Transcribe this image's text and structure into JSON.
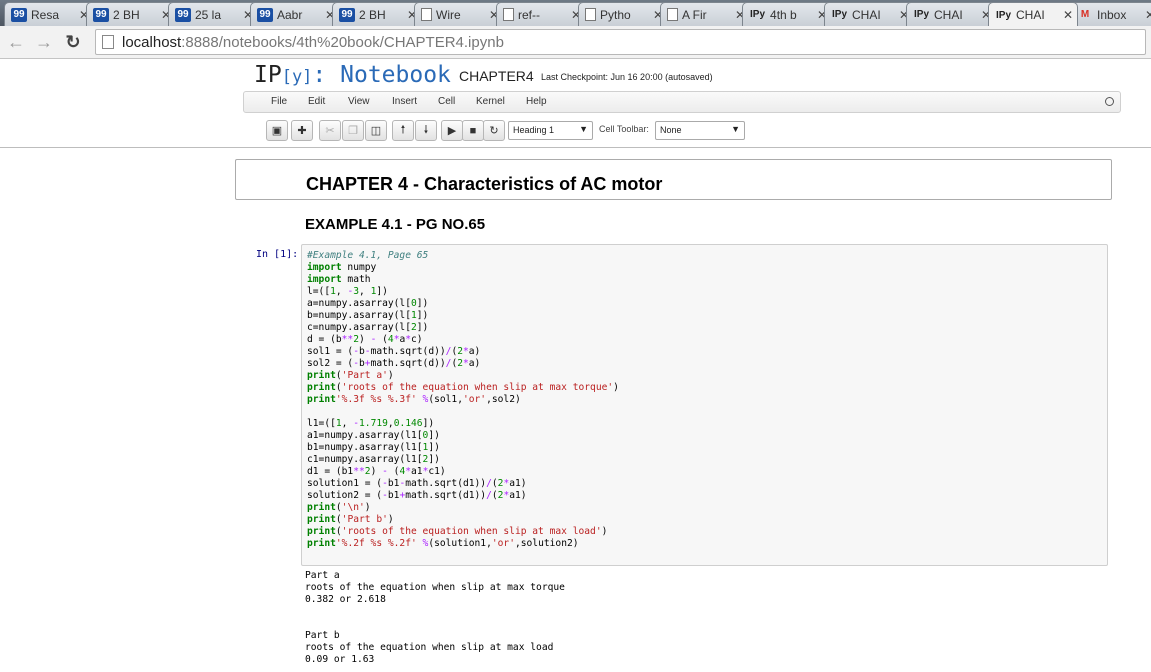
{
  "browser": {
    "tabs": [
      {
        "icon": "99",
        "label": "Resa"
      },
      {
        "icon": "99",
        "label": "2 BH"
      },
      {
        "icon": "99",
        "label": "25 la"
      },
      {
        "icon": "99",
        "label": "Aabr"
      },
      {
        "icon": "99",
        "label": "2 BH"
      },
      {
        "icon": "page",
        "label": "Wire"
      },
      {
        "icon": "page",
        "label": "ref--"
      },
      {
        "icon": "page",
        "label": "Pytho"
      },
      {
        "icon": "page",
        "label": "A Fir"
      },
      {
        "icon": "IPy",
        "label": "4th b"
      },
      {
        "icon": "IPy",
        "label": "CHAI"
      },
      {
        "icon": "IPy",
        "label": "CHAI"
      },
      {
        "icon": "IPy",
        "label": "CHAI"
      },
      {
        "icon": "M",
        "label": "Inbox"
      }
    ],
    "active_tab_index": 12,
    "url_host": "localhost",
    "url_path": ":8888/notebooks/4th%20book/CHAPTER4.ipynb"
  },
  "notebook": {
    "logo_ip": "IP",
    "logo_y": "[y]",
    "logo_colon": ":",
    "logo_notebook": " Notebook",
    "name": "CHAPTER4",
    "checkpoint": "Last Checkpoint: Jun 16 20:00 (autosaved)",
    "menu": [
      "File",
      "Edit",
      "View",
      "Insert",
      "Cell",
      "Kernel",
      "Help"
    ],
    "cell_type_select": "Heading 1",
    "cell_toolbar_label": "Cell Toolbar:",
    "cell_toolbar_select": "None"
  },
  "content": {
    "heading1": "CHAPTER 4 - Characteristics of AC motor",
    "heading2": "EXAMPLE 4.1 - PG NO.65",
    "prompt": "In [1]:",
    "output_lines": [
      "Part a",
      "roots of the equation when slip at max torque",
      "0.382 or 2.618",
      "",
      "",
      "Part b",
      "roots of the equation when slip at max load",
      "0.09 or 1.63"
    ]
  }
}
